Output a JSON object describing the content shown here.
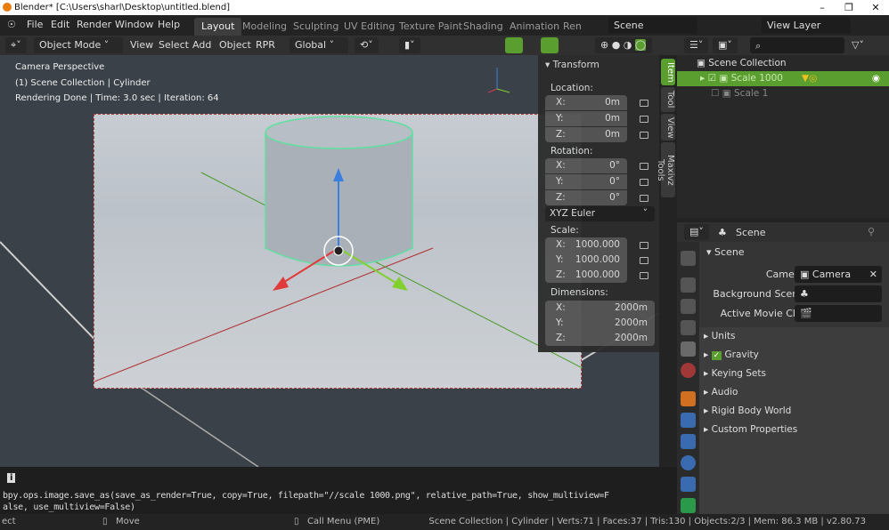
{
  "window": {
    "title": "Blender* [C:\\Users\\sharl\\Desktop\\untitled.blend]",
    "minimize": "–",
    "maximize": "❐",
    "close": "✕"
  },
  "menu": [
    "File",
    "Edit",
    "Render",
    "Window",
    "Help"
  ],
  "workspaces": [
    "Layout",
    "Modeling",
    "Sculpting",
    "UV Editing",
    "Texture Paint",
    "Shading",
    "Animation",
    "Ren"
  ],
  "scene_field": "Scene",
  "view_layer_field": "View Layer",
  "viewport_header": {
    "mode": "Object Mode",
    "items": [
      "View",
      "Select",
      "Add",
      "Object",
      "RPR"
    ],
    "orientation": "Global"
  },
  "overlay": {
    "line1": "Camera Perspective",
    "line2": "(1) Scene Collection | Cylinder",
    "line3": "Rendering Done | Time: 3.0 sec | Iteration: 64"
  },
  "transform": {
    "header": "Transform",
    "location_label": "Location:",
    "location": [
      {
        "k": "X:",
        "v": "0m"
      },
      {
        "k": "Y:",
        "v": "0m"
      },
      {
        "k": "Z:",
        "v": "0m"
      }
    ],
    "rotation_label": "Rotation:",
    "rotation": [
      {
        "k": "X:",
        "v": "0°"
      },
      {
        "k": "Y:",
        "v": "0°"
      },
      {
        "k": "Z:",
        "v": "0°"
      }
    ],
    "rotation_mode": "XYZ Euler",
    "scale_label": "Scale:",
    "scale": [
      {
        "k": "X:",
        "v": "1000.000"
      },
      {
        "k": "Y:",
        "v": "1000.000"
      },
      {
        "k": "Z:",
        "v": "1000.000"
      }
    ],
    "dimensions_label": "Dimensions:",
    "dimensions": [
      {
        "k": "X:",
        "v": "2000m"
      },
      {
        "k": "Y:",
        "v": "2000m"
      },
      {
        "k": "Z:",
        "v": "2000m"
      }
    ]
  },
  "side_tabs": [
    "Item",
    "Tool",
    "View",
    "Maxivz Tools"
  ],
  "outliner": {
    "root": "Scene Collection",
    "items": [
      {
        "name": "Scale 1000",
        "checked": true,
        "selected": true
      },
      {
        "name": "Scale 1",
        "checked": false,
        "selected": false
      }
    ]
  },
  "properties": {
    "context": "Scene",
    "section": "Scene",
    "camera_label": "Camera",
    "camera_value": "Camera",
    "bg_scene_label": "Background Scene",
    "movie_clip_label": "Active Movie Clip",
    "panels": [
      "Units",
      "Gravity",
      "Keying Sets",
      "Audio",
      "Rigid Body World",
      "Custom Properties"
    ]
  },
  "console": {
    "line1": "bpy.ops.image.save_as(save_as_render=True, copy=True, filepath=\"//scale 1000.png\", relative_path=True, show_multiview=F",
    "line2": "alse, use_multiview=False)"
  },
  "status": {
    "left": "ect",
    "move": "Move",
    "call_menu": "Call Menu (PME)",
    "info": "Scene Collection | Cylinder | Verts:71 | Faces:37 | Tris:130 | Objects:2/3 | Mem: 86.3 MB | v2.80.73"
  },
  "colors": {
    "accent": "#5a9e2f",
    "selection_outline": "#5fe0a0"
  }
}
